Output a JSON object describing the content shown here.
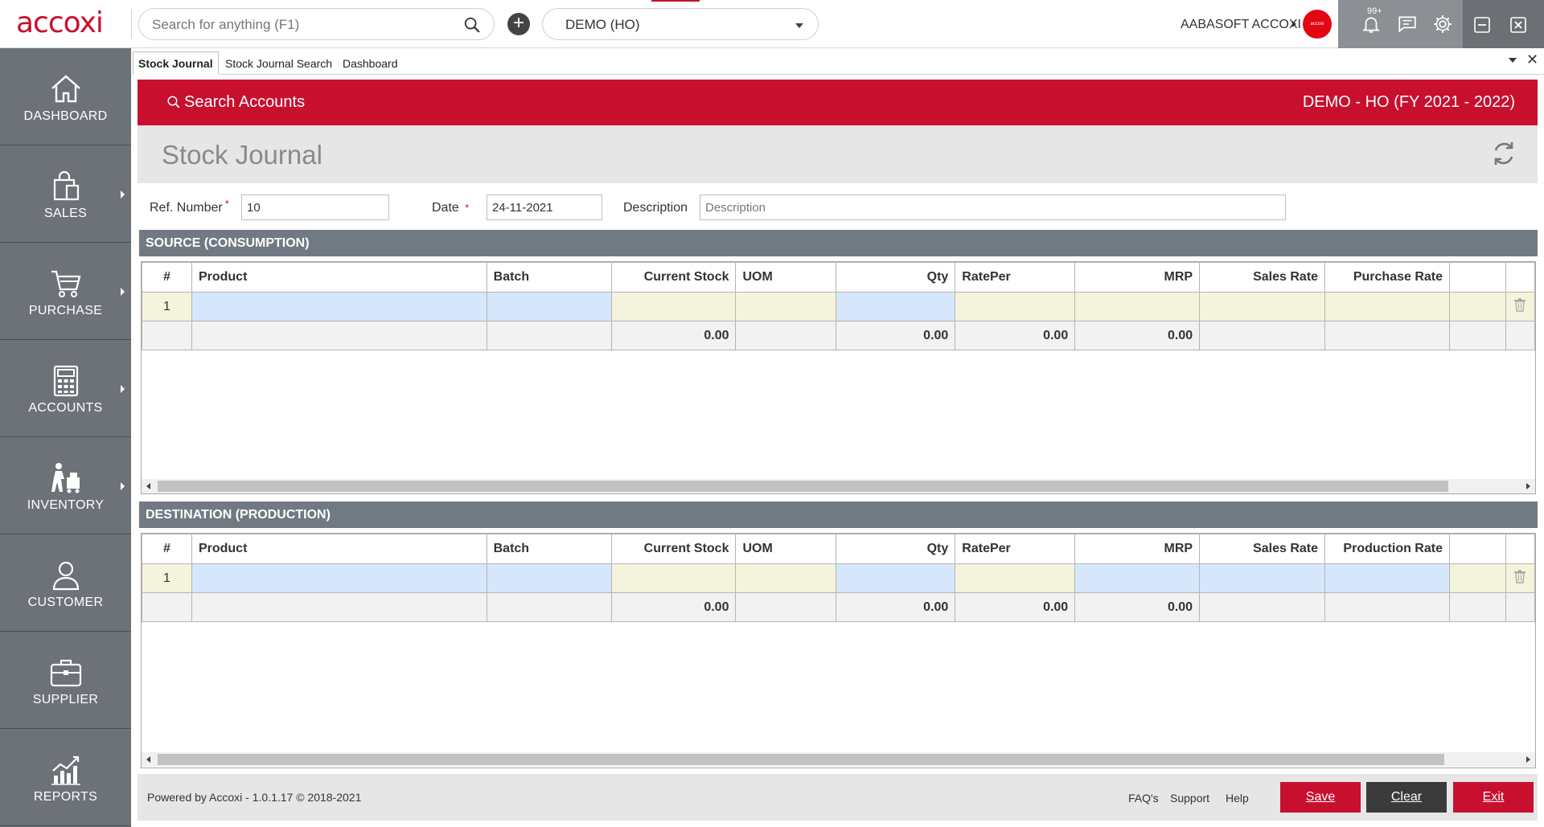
{
  "app": {
    "logo": "accoxi",
    "search_placeholder": "Search for anything (F1)",
    "company_selected": "DEMO (HO)",
    "user_name": "AABASOFT ACCOXI",
    "notification_count": "99+",
    "avatar_text": "accoxi"
  },
  "sidebar": {
    "items": [
      {
        "label": "DASHBOARD",
        "icon": "home-icon",
        "has_submenu": false
      },
      {
        "label": "SALES",
        "icon": "shopping-bag-icon",
        "has_submenu": true
      },
      {
        "label": "PURCHASE",
        "icon": "cart-icon",
        "has_submenu": true
      },
      {
        "label": "ACCOUNTS",
        "icon": "calculator-icon",
        "has_submenu": true
      },
      {
        "label": "INVENTORY",
        "icon": "inventory-icon",
        "has_submenu": true
      },
      {
        "label": "CUSTOMER",
        "icon": "user-icon",
        "has_submenu": false
      },
      {
        "label": "SUPPLIER",
        "icon": "briefcase-icon",
        "has_submenu": false
      },
      {
        "label": "REPORTS",
        "icon": "chart-icon",
        "has_submenu": false
      }
    ]
  },
  "tabs": [
    {
      "label": "Stock Journal",
      "active": true
    },
    {
      "label": "Stock Journal Search",
      "active": false
    },
    {
      "label": "Dashboard",
      "active": false
    }
  ],
  "header": {
    "search_accounts": "Search Accounts",
    "company_fy": "DEMO - HO (FY 2021 - 2022)"
  },
  "page": {
    "title": "Stock Journal"
  },
  "form": {
    "ref_label": "Ref. Number",
    "ref_value": "10",
    "date_label": "Date",
    "date_value": "24-11-2021",
    "description_label": "Description",
    "description_placeholder": "Description",
    "required_mark": "*"
  },
  "source": {
    "title": "SOURCE (CONSUMPTION)",
    "columns": [
      "#",
      "Product",
      "Batch",
      "Current Stock",
      "UOM",
      "Qty",
      "RatePer",
      "MRP",
      "Sales Rate",
      "Purchase Rate",
      ""
    ],
    "rows": [
      {
        "no": "1",
        "product": "",
        "batch": "",
        "current_stock": "",
        "uom": "",
        "qty": "",
        "rate_per": "",
        "mrp": "",
        "sales_rate": "",
        "purchase_rate": ""
      }
    ],
    "totals": {
      "current_stock": "0.00",
      "qty": "0.00",
      "rate_per": "0.00",
      "mrp": "0.00"
    }
  },
  "destination": {
    "title": "DESTINATION (PRODUCTION)",
    "columns": [
      "#",
      "Product",
      "Batch",
      "Current Stock",
      "UOM",
      "Qty",
      "RatePer",
      "MRP",
      "Sales Rate",
      "Production Rate",
      ""
    ],
    "rows": [
      {
        "no": "1",
        "product": "",
        "batch": "",
        "current_stock": "",
        "uom": "",
        "qty": "",
        "rate_per": "",
        "mrp": "",
        "sales_rate": "",
        "production_rate": ""
      }
    ],
    "totals": {
      "current_stock": "0.00",
      "qty": "0.00",
      "rate_per": "0.00",
      "mrp": "0.00"
    }
  },
  "footer": {
    "powered_by": "Powered by Accoxi - 1.0.1.17 © 2018-2021",
    "links": [
      "FAQ's",
      "Support",
      "Help"
    ],
    "save": "Save",
    "clear": "Clear",
    "exit": "Exit"
  },
  "colors": {
    "brand_red": "#c8102e",
    "sidebar": "#6c7278",
    "section_header": "#717a82",
    "clear_button": "#3a3a3a"
  }
}
